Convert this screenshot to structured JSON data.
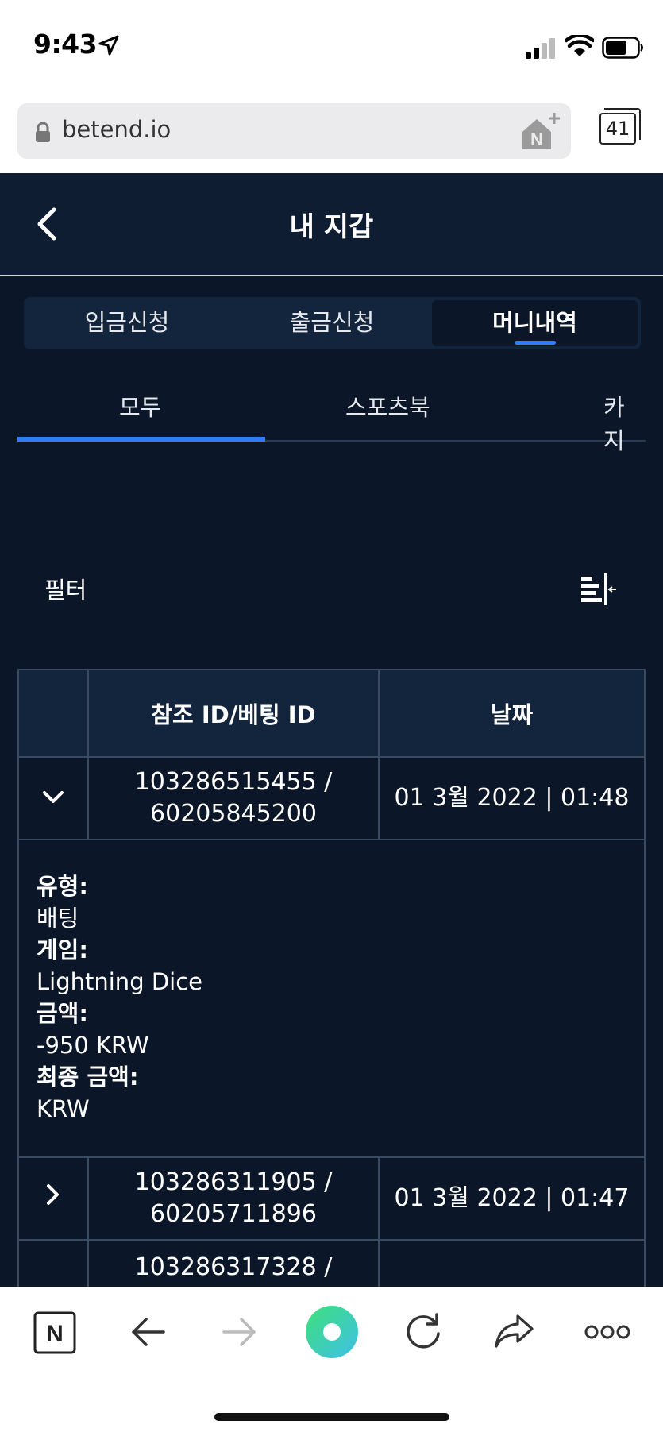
{
  "status": {
    "time": "9:43"
  },
  "browser": {
    "url": "betend.io",
    "tab_count": "41"
  },
  "header": {
    "title": "내 지갑"
  },
  "segments": [
    {
      "label": "입금신청",
      "active": false
    },
    {
      "label": "출금신청",
      "active": false
    },
    {
      "label": "머니내역",
      "active": true
    }
  ],
  "subtabs": [
    {
      "label": "모두",
      "active": true
    },
    {
      "label": "스포츠북",
      "active": false
    },
    {
      "label": "카지",
      "active": false
    }
  ],
  "filter": {
    "label": "필터"
  },
  "table": {
    "headers": [
      "참조 ID/베팅 ID",
      "날짜"
    ],
    "rows": [
      {
        "ref": "103286515455 /",
        "bet": "60205845200",
        "date": "01 3월 2022 | 01:48",
        "expanded": true
      },
      {
        "ref": "103286311905 /",
        "bet": "60205711896",
        "date": "01 3월 2022 | 01:47",
        "expanded": false
      },
      {
        "ref": "103286317328 /",
        "bet": "",
        "date": "",
        "expanded": false
      }
    ],
    "detail": {
      "type_label": "유형:",
      "type_value": "배팅",
      "game_label": "게임:",
      "game_value": "Lightning Dice",
      "amount_label": "금액:",
      "amount_value": "-950 KRW",
      "final_label": "최종 금액:",
      "final_value": "KRW"
    }
  },
  "colors": {
    "bg": "#0b1729",
    "panel": "#13243d",
    "accent": "#2e7cf6"
  },
  "toolbar_icons": [
    "naver-icon",
    "back-arrow-icon",
    "forward-arrow-icon",
    "record-icon",
    "reload-icon",
    "share-icon",
    "more-icon"
  ]
}
